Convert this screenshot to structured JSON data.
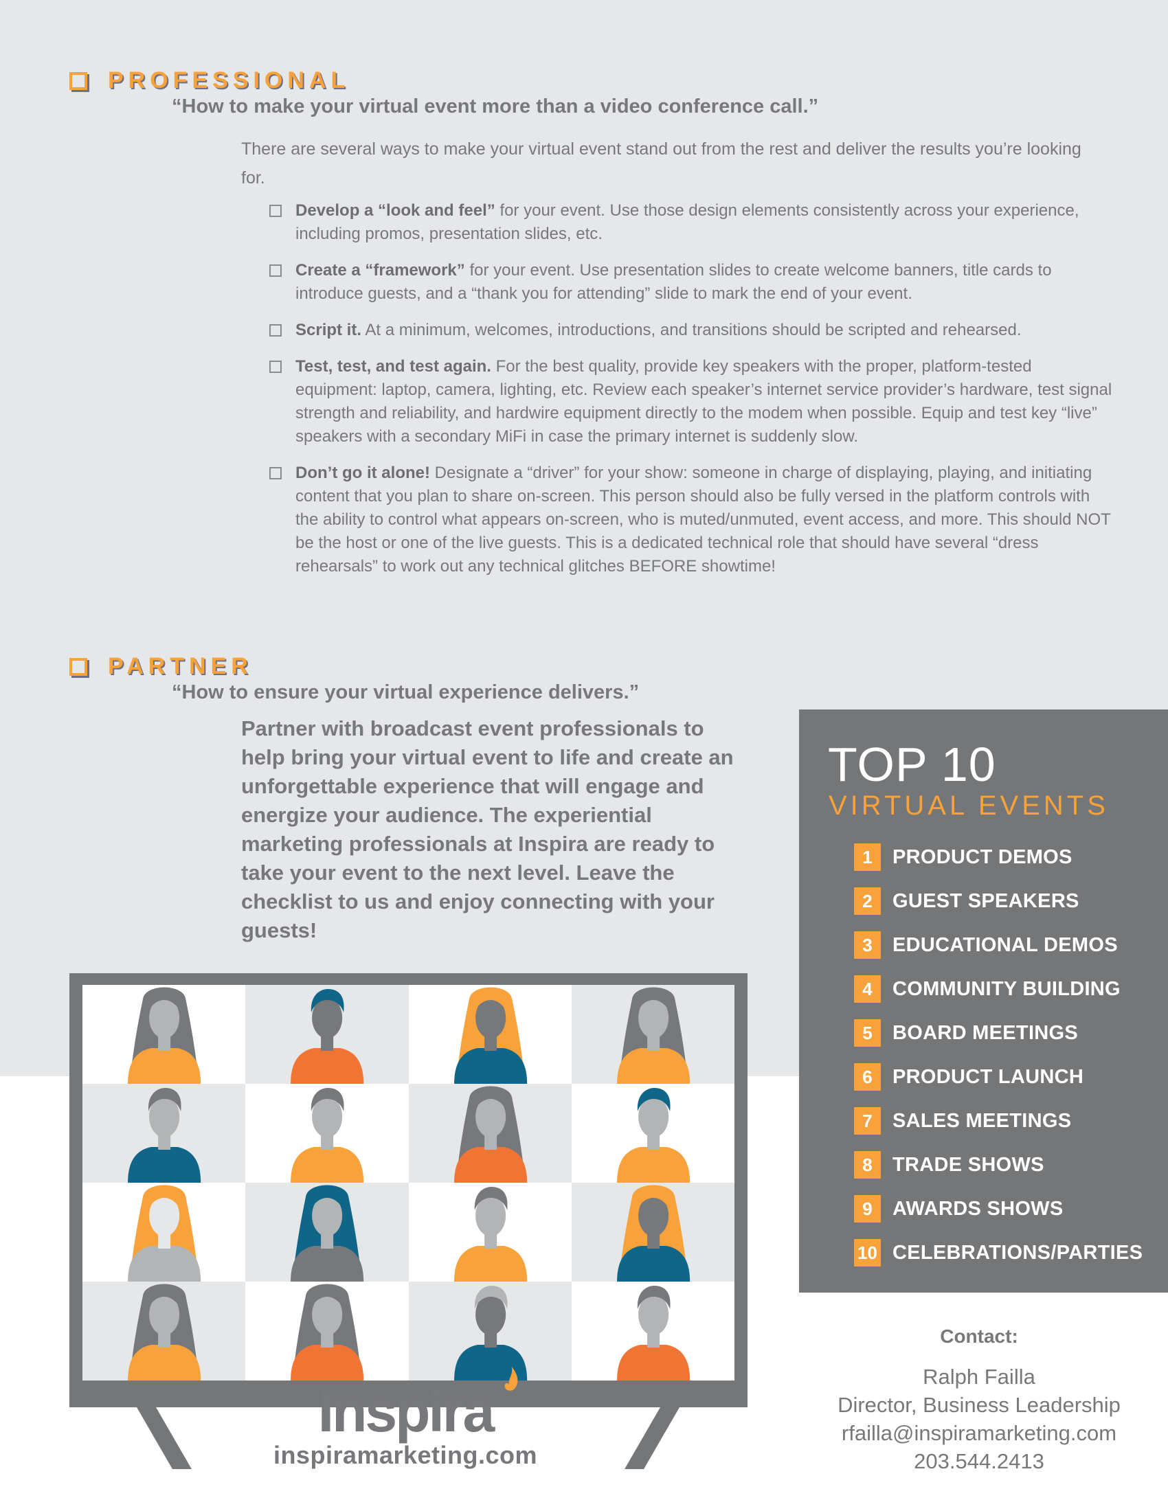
{
  "colors": {
    "accent_orange": "#f7a23b",
    "deep_orange": "#f07535",
    "teal": "#0f6688",
    "gray_text": "#77787b",
    "panel_gray": "#757678",
    "bg_light": "#e6e7e8"
  },
  "professional": {
    "icon": "checkbox-icon",
    "title": "PROFESSIONAL",
    "quote": "“How to make your virtual event more than a video conference call.”",
    "intro": "There are several ways to make your virtual event stand out from the rest and deliver the results you’re looking for.",
    "items": [
      {
        "bold": "Develop a “look and feel”",
        "text": " for your event. Use those design elements consistently across your experience, including promos, presentation slides, etc."
      },
      {
        "bold": "Create a “framework”",
        "text": " for your event. Use presentation slides to create welcome banners, title cards to introduce guests, and a “thank you for attending” slide to mark the end of your event."
      },
      {
        "bold": "Script it.",
        "text": " At a minimum, welcomes, introductions, and transitions should be scripted and rehearsed."
      },
      {
        "bold": "Test, test, and test again.",
        "text": " For the best quality, provide key speakers with the proper, platform-tested equipment: laptop, camera, lighting, etc.  Review each speaker’s internet service provider’s hardware, test signal strength and reliability, and hardwire equipment directly to the modem when possible. Equip and test key “live” speakers with a secondary MiFi in case the primary internet is suddenly slow."
      },
      {
        "bold": "Don’t go it alone!",
        "text": " Designate a “driver” for your show: someone in charge of displaying, playing, and initiating content that you plan to share on-screen. This person should also be fully versed in the platform controls with the ability to control what appears on-screen, who is muted/unmuted, event access, and more. This should NOT be the host or one of the live guests. This is a dedicated technical role that should have several “dress rehearsals” to work out any technical glitches BEFORE showtime!"
      }
    ]
  },
  "partner": {
    "icon": "checkbox-icon",
    "title": "PARTNER",
    "quote": "“How to ensure your virtual experience delivers.”",
    "body": "Partner with broadcast event professionals to help bring your virtual event to life and create an unforgettable experience that will engage and energize your audience. The experiential marketing professionals at Inspira are ready to take your event to the next level. Leave the checklist to us and enjoy connecting with your guests!"
  },
  "top10": {
    "title": "TOP 10",
    "subtitle": "VIRTUAL EVENTS",
    "items": [
      {
        "num": "1",
        "label": "PRODUCT DEMOS"
      },
      {
        "num": "2",
        "label": "GUEST SPEAKERS"
      },
      {
        "num": "3",
        "label": "EDUCATIONAL DEMOS"
      },
      {
        "num": "4",
        "label": "COMMUNITY BUILDING"
      },
      {
        "num": "5",
        "label": "BOARD MEETINGS"
      },
      {
        "num": "6",
        "label": "PRODUCT LAUNCH"
      },
      {
        "num": "7",
        "label": "SALES MEETINGS"
      },
      {
        "num": "8",
        "label": "TRADE SHOWS"
      },
      {
        "num": "9",
        "label": "AWARDS SHOWS"
      },
      {
        "num": "10",
        "label": "CELEBRATIONS/PARTIES"
      }
    ]
  },
  "contact": {
    "heading": "Contact:",
    "name": "Ralph Failla",
    "title": "Director, Business Leadership",
    "email": "rfailla@inspiramarketing.com",
    "phone": "203.544.2413"
  },
  "logo": {
    "wordmark": "Inspira",
    "icon": "flame-icon",
    "url": "inspiramarketing.com"
  },
  "video_grid": {
    "icon": "video-conference-tv-illustration",
    "tiles": [
      {
        "bg": "#ffffff",
        "hair": "#77787b",
        "skin": "#b3b4b5",
        "shirt": "#f7a23b",
        "long_hair": true
      },
      {
        "bg": "#e6e7e8",
        "hair": "#0f6688",
        "skin": "#77787b",
        "shirt": "#f07535",
        "long_hair": false
      },
      {
        "bg": "#ffffff",
        "hair": "#f7a23b",
        "skin": "#77787b",
        "shirt": "#0f6688",
        "long_hair": true
      },
      {
        "bg": "#e6e7e8",
        "hair": "#77787b",
        "skin": "#b3b4b5",
        "shirt": "#f7a23b",
        "long_hair": true
      },
      {
        "bg": "#e6e7e8",
        "hair": "#77787b",
        "skin": "#b3b4b5",
        "shirt": "#0f6688",
        "long_hair": false
      },
      {
        "bg": "#ffffff",
        "hair": "#77787b",
        "skin": "#b3b4b5",
        "shirt": "#f7a23b",
        "long_hair": false
      },
      {
        "bg": "#e6e7e8",
        "hair": "#77787b",
        "skin": "#b3b4b5",
        "shirt": "#f07535",
        "long_hair": true
      },
      {
        "bg": "#ffffff",
        "hair": "#0f6688",
        "skin": "#b3b4b5",
        "shirt": "#f7a23b",
        "long_hair": false
      },
      {
        "bg": "#ffffff",
        "hair": "#f7a23b",
        "skin": "#e6e7e8",
        "shirt": "#b3b4b5",
        "long_hair": true
      },
      {
        "bg": "#e6e7e8",
        "hair": "#0f6688",
        "skin": "#b3b4b5",
        "shirt": "#77787b",
        "long_hair": true
      },
      {
        "bg": "#ffffff",
        "hair": "#77787b",
        "skin": "#b3b4b5",
        "shirt": "#f7a23b",
        "long_hair": false
      },
      {
        "bg": "#e6e7e8",
        "hair": "#f7a23b",
        "skin": "#77787b",
        "shirt": "#0f6688",
        "long_hair": true
      },
      {
        "bg": "#e6e7e8",
        "hair": "#77787b",
        "skin": "#b3b4b5",
        "shirt": "#f7a23b",
        "long_hair": true
      },
      {
        "bg": "#ffffff",
        "hair": "#77787b",
        "skin": "#b3b4b5",
        "shirt": "#f07535",
        "long_hair": true
      },
      {
        "bg": "#e6e7e8",
        "hair": "#b3b4b5",
        "skin": "#77787b",
        "shirt": "#0f6688",
        "long_hair": false
      },
      {
        "bg": "#ffffff",
        "hair": "#77787b",
        "skin": "#b3b4b5",
        "shirt": "#f07535",
        "long_hair": false
      }
    ]
  }
}
